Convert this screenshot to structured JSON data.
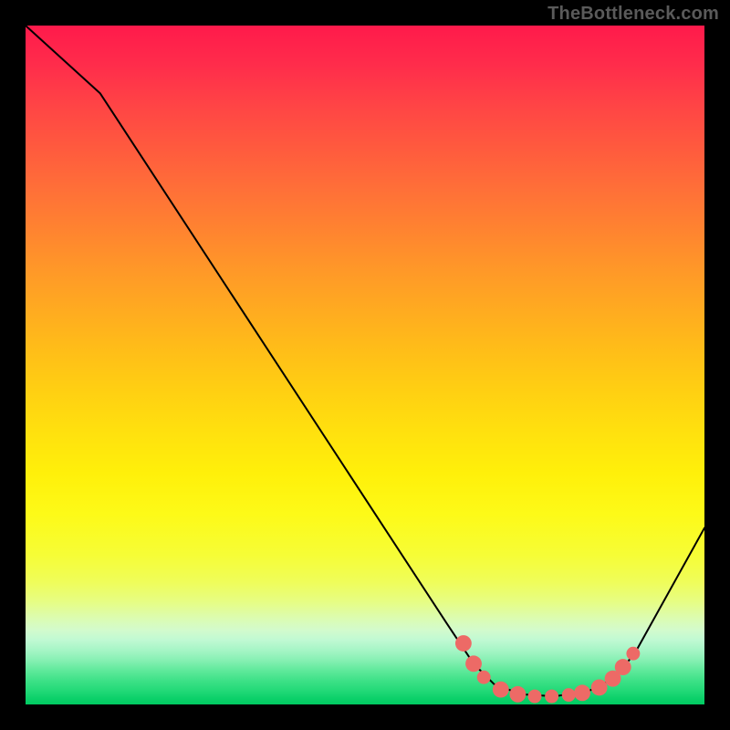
{
  "watermark": "TheBottleneck.com",
  "chart_data": {
    "type": "line",
    "title": "",
    "xlabel": "",
    "ylabel": "",
    "xlim": [
      0,
      100
    ],
    "ylim": [
      0,
      100
    ],
    "grid": false,
    "legend": false,
    "curve": [
      {
        "x": 0,
        "y": 100
      },
      {
        "x": 11,
        "y": 90
      },
      {
        "x": 62,
        "y": 12
      },
      {
        "x": 66,
        "y": 6
      },
      {
        "x": 69,
        "y": 3
      },
      {
        "x": 73,
        "y": 1.5
      },
      {
        "x": 78,
        "y": 1.2
      },
      {
        "x": 83,
        "y": 2
      },
      {
        "x": 87,
        "y": 4
      },
      {
        "x": 90,
        "y": 8
      },
      {
        "x": 100,
        "y": 26
      }
    ],
    "dots": [
      {
        "x": 64.5,
        "y": 9,
        "r": 1.2
      },
      {
        "x": 66,
        "y": 6,
        "r": 1.2
      },
      {
        "x": 67.5,
        "y": 4,
        "r": 1.0
      },
      {
        "x": 70,
        "y": 2.2,
        "r": 1.2
      },
      {
        "x": 72.5,
        "y": 1.5,
        "r": 1.2
      },
      {
        "x": 75,
        "y": 1.2,
        "r": 1.0
      },
      {
        "x": 77.5,
        "y": 1.2,
        "r": 1.0
      },
      {
        "x": 80,
        "y": 1.4,
        "r": 1.0
      },
      {
        "x": 82,
        "y": 1.7,
        "r": 1.2
      },
      {
        "x": 84.5,
        "y": 2.5,
        "r": 1.2
      },
      {
        "x": 86.5,
        "y": 3.8,
        "r": 1.2
      },
      {
        "x": 88,
        "y": 5.5,
        "r": 1.2
      },
      {
        "x": 89.5,
        "y": 7.5,
        "r": 1.0
      }
    ]
  }
}
